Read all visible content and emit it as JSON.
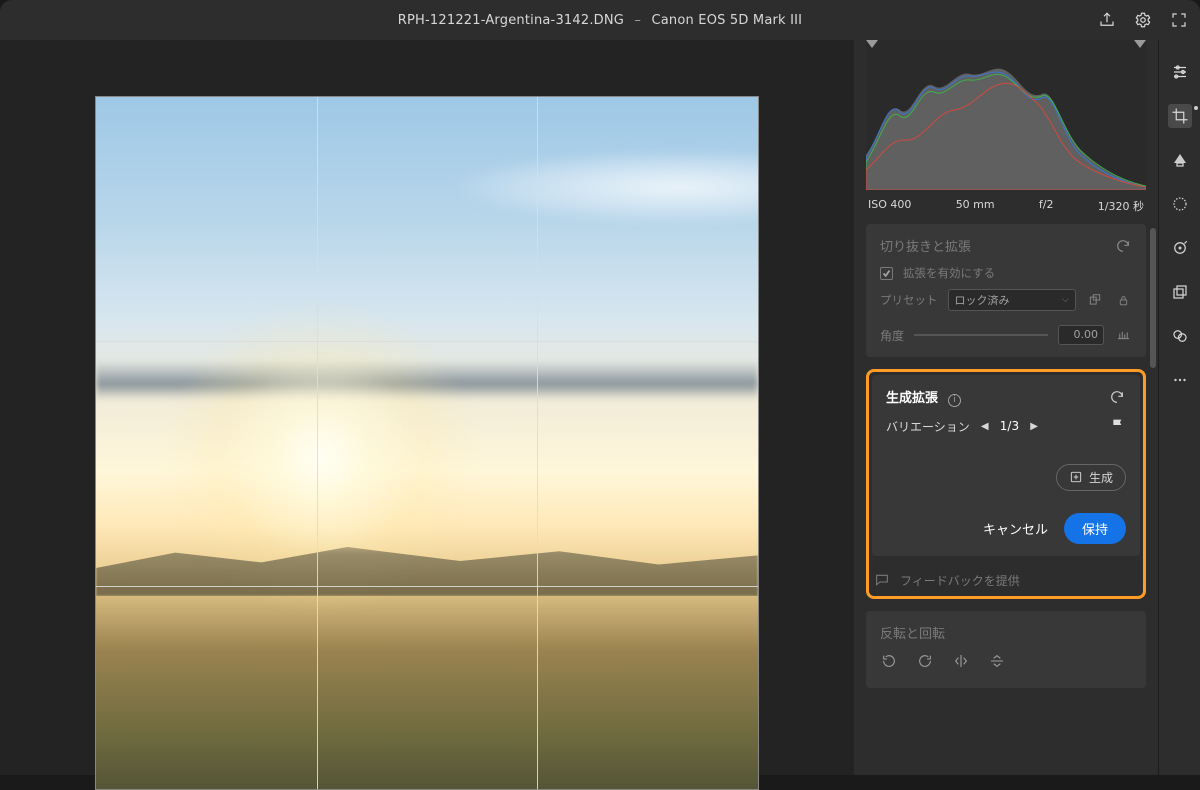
{
  "title": {
    "filename": "RPH-121221-Argentina-3142.DNG",
    "camera": "Canon EOS 5D Mark III"
  },
  "exif": {
    "iso": "ISO 400",
    "focal": "50 mm",
    "aperture": "f/2",
    "shutter": "1/320 秒"
  },
  "crop": {
    "title": "切り抜きと拡張",
    "enable_label": "拡張を有効にする",
    "preset_label": "プリセット",
    "preset_value": "ロック済み",
    "angle_label": "角度",
    "angle_value": "0.00"
  },
  "gen": {
    "title": "生成拡張",
    "variation_label": "バリエーション",
    "variation_count": "1/3",
    "generate_label": "生成",
    "cancel_label": "キャンセル",
    "keep_label": "保持",
    "feedback_label": "フィードバックを提供"
  },
  "flip": {
    "title": "反転と回転"
  }
}
